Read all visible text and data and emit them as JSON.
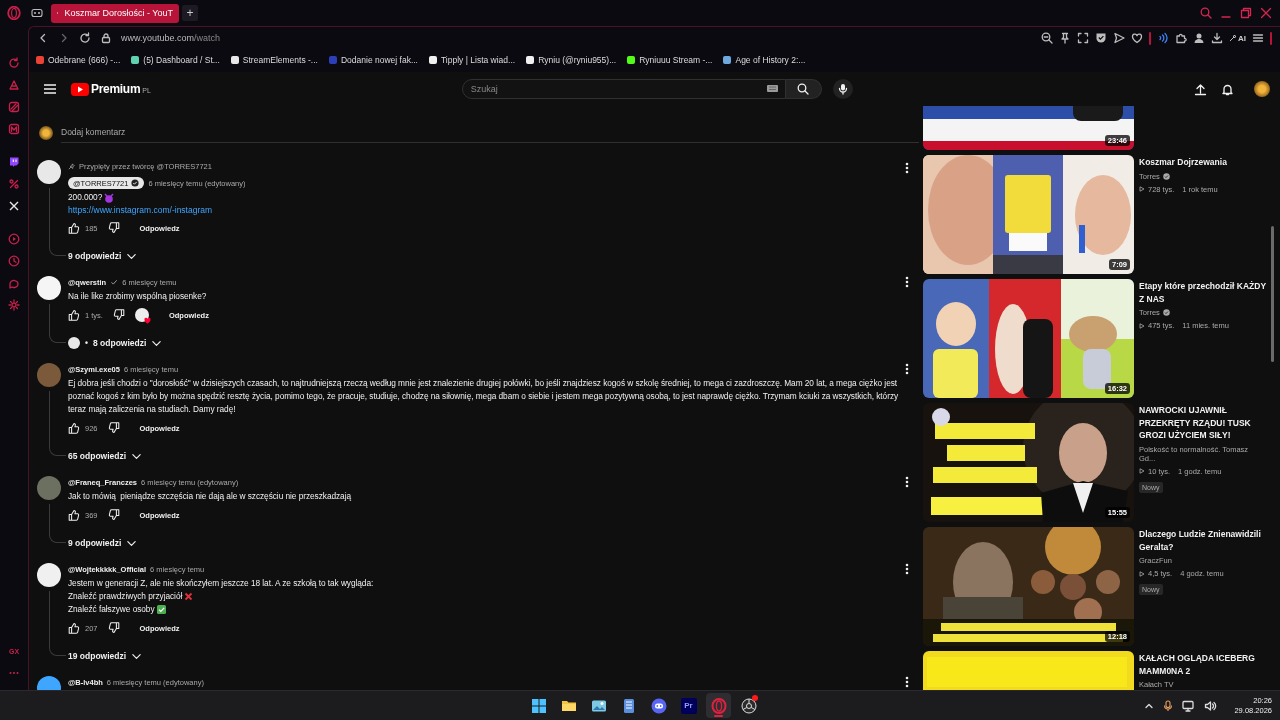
{
  "browser": {
    "tabs": [
      {
        "title": "Koszmar Dorosłości - YouT",
        "selected": true
      }
    ],
    "new_tab": "+",
    "address": {
      "host": "www.youtube.com",
      "path": "/watch"
    },
    "toolbar_ai": "AI",
    "bookmarks": [
      {
        "label": "Odebrane (666) -...",
        "color": "#ea4335"
      },
      {
        "label": "(5) Dashboard / St...",
        "color": "#5fd3b0"
      },
      {
        "label": "StreamElements -...",
        "color": "#e8e8e8"
      },
      {
        "label": "Dodanie nowej fak...",
        "color": "#2a3fb8"
      },
      {
        "label": "Tipply | Lista wiad...",
        "color": "#f0f0f0"
      },
      {
        "label": "Ryniu (@ryniu955)...",
        "color": "#f0f0f0"
      },
      {
        "label": "Ryniuuu Stream -...",
        "color": "#53fc18"
      },
      {
        "label": "Age of History 2:...",
        "color": "#6fa8dc"
      }
    ],
    "rail_badge": "GX"
  },
  "youtube": {
    "logo": "Premium",
    "region": "PL",
    "search": {
      "placeholder": "Szukaj"
    },
    "add_comment": {
      "placeholder": "Dodaj komentarz"
    },
    "comments": [
      {
        "pinned": "Przypięty przez twórcę @TORRES7721",
        "author": "@TORRES7721",
        "author_highlighted": true,
        "badge": {
          "kind": "circle"
        },
        "time": "6 miesięcy temu (edytowany)",
        "lines": [
          {
            "kind": "devil",
            "text": "200.000?"
          }
        ],
        "link": "https://www.instagram.com/-instagram",
        "likes": "185",
        "reply": "Odpowiedz",
        "creator_heart": false,
        "replies": "9 odpowiedzi",
        "creator_replied": false
      },
      {
        "author": "@qwerstin",
        "author_highlighted": false,
        "badge": {
          "kind": "check"
        },
        "time": "6 miesięcy temu",
        "lines": [
          {
            "kind": "plain",
            "text": "Na ile like zrobimy wspólną piosenke?"
          }
        ],
        "likes": "1 tys.",
        "reply": "Odpowiedz",
        "creator_heart": true,
        "replies": "8 odpowiedzi",
        "creator_replied": true,
        "replies_prefix": "•"
      },
      {
        "author": "@Szymi.exe05",
        "author_highlighted": false,
        "time": "6 miesięcy temu",
        "lines": [
          {
            "kind": "plain",
            "text": "Ej dobra jeśli chodzi o \"dorosłość\" w dzisiejszych czasach, to najtrudniejszą rzeczą według mnie jest znalezienie drugiej połówki, bo jeśli znajdziesz kogoś w szkolę średniej, to mega ci zazdroszczę. Mam 20 lat, a mega ciężko jest poznać kogoś z kim było by można spędzić resztę życia, pomimo tego, że pracuje, studiuje, chodzę na siłownię, mega dbam o siebie i jestem mega pozytywną osobą, to jest naprawdę ciężko. Trzymam kciuki za wszystkich, którzy teraz mają zaliczenia na studiach. Damy radę!"
          }
        ],
        "likes": "926",
        "reply": "Odpowiedz",
        "creator_heart": false,
        "replies": "65 odpowiedzi",
        "creator_replied": false
      },
      {
        "author": "@Franeq_Franczes",
        "author_highlighted": false,
        "time": "6 miesięcy temu (edytowany)",
        "lines": [
          {
            "kind": "plain",
            "text": "Jak to mówią  pieniądze szczęścia nie dają ale w szczęściu nie przeszkadzają"
          }
        ],
        "likes": "369",
        "reply": "Odpowiedz",
        "creator_heart": false,
        "replies": "9 odpowiedzi",
        "creator_replied": false
      },
      {
        "author": "@Wojtekkkkk_Official",
        "author_highlighted": false,
        "time": "6 miesięcy temu",
        "lines": [
          {
            "kind": "plain",
            "text": "Jestem w generacji Z, ale nie skończyłem jeszcze 18 lat. A ze szkołą to tak wygląda:"
          },
          {
            "kind": "cross",
            "text": "Znaleźć prawdziwych przyjaciół"
          },
          {
            "kind": "check",
            "text": "Znaleźć fałszywe osoby"
          }
        ],
        "likes": "207",
        "reply": "Odpowiedz",
        "creator_heart": false,
        "replies": "19 odpowiedzi",
        "creator_replied": false
      },
      {
        "author": "@B-lv4bh",
        "author_highlighted": false,
        "time": "6 miesięcy temu (edytowany)"
      }
    ]
  },
  "related_videos": [
    {
      "duration": "23:46"
    },
    {
      "duration": "7:09",
      "title": "Koszmar Dojrzewania",
      "channel": "Torres",
      "verified": true,
      "views": "728 tys.",
      "age": "1 rok temu"
    },
    {
      "duration": "16:32",
      "title": "Etapy które przechodził KAŻDY Z NAS",
      "channel": "Torres",
      "verified": true,
      "views": "475 tys.",
      "age": "11 mies. temu"
    },
    {
      "duration": "15:55",
      "title": "NAWROCKI UJAWNIŁ PRZEKRĘTY RZĄDU! TUSK GROZI UŻYCIEM SIŁY!",
      "channel": "Polskość to normalność. Tomasz Gd...",
      "verified": false,
      "views": "10 tys.",
      "age": "1 godz. temu",
      "badge": "Nowy"
    },
    {
      "duration": "12:18",
      "title": "Dlaczego Ludzie Znienawidzili Geralta?",
      "channel": "GraczFun",
      "verified": false,
      "views": "4,5 tys.",
      "age": "4 godz. temu",
      "badge": "Nowy"
    },
    {
      "title": "KAŁACH OGLĄDA ICEBERG MAMM0NA 2",
      "channel": "Kałach TV",
      "verified": false
    }
  ],
  "taskbar": {
    "apps": [
      {
        "kind": "windows",
        "active": false,
        "notification": false
      },
      {
        "kind": "folder",
        "active": false,
        "notification": false
      },
      {
        "kind": "photos",
        "active": false,
        "notification": false
      },
      {
        "kind": "document",
        "active": false,
        "notification": false
      },
      {
        "kind": "chat",
        "active": false,
        "notification": false
      },
      {
        "kind": "editor",
        "label": "Pr",
        "active": false,
        "notification": false
      },
      {
        "kind": "opera",
        "active": true,
        "notification": false
      },
      {
        "kind": "recorder",
        "active": false,
        "notification": true
      }
    ],
    "time": "20:26",
    "date": "29.08.2026"
  }
}
